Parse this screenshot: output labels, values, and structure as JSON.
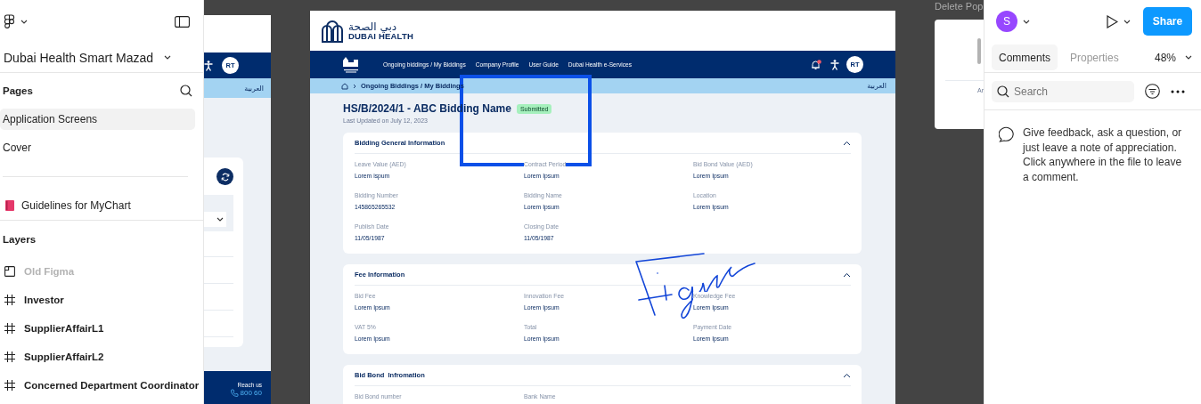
{
  "left_panel": {
    "file_title": "Dubai Health Smart Mazad",
    "pages_heading": "Pages",
    "pages": [
      {
        "label": "Application Screens",
        "selected": true
      },
      {
        "label": "Cover",
        "selected": false
      }
    ],
    "pinned_page": "Guidelines for MyChart",
    "layers_heading": "Layers",
    "layers": [
      {
        "label": "Old Figma",
        "kind": "section",
        "dimmed": true
      },
      {
        "label": "Investor",
        "kind": "frame",
        "dimmed": false
      },
      {
        "label": "SupplierAffairL1",
        "kind": "frame",
        "dimmed": false
      },
      {
        "label": "SupplierAffairL2",
        "kind": "frame",
        "dimmed": false
      },
      {
        "label": "Concerned Department  Coordinator",
        "kind": "frame",
        "dimmed": false
      }
    ]
  },
  "canvas": {
    "left_frame": {
      "avatar": "RT",
      "language": "العربية",
      "footer_label": "Reach us",
      "footer_phone": "800 60"
    },
    "main_frame": {
      "logo_arabic": "دبي الصحة",
      "logo_latin": "DUBAI HEALTH",
      "nav": [
        "Ongoing biddings / My Biddings",
        "Company Profile",
        "User Guide",
        "Dubai Health e-Services"
      ],
      "avatar": "RT",
      "breadcrumb": "Ongoing Biddings / My Biddings",
      "language": "العربية",
      "title": "HS/B/2024/1 - ABC Bidding Name",
      "status": "Submitted",
      "updated": "Last Updated on July 12, 2023",
      "sections": [
        {
          "title": "Bidding General Information",
          "expanded": true,
          "fields": [
            {
              "label": "Leave Value (AED)",
              "value": "Lorem ispum"
            },
            {
              "label": "Contract Period",
              "value": "Lorem Ipsum"
            },
            {
              "label": "Bid Bond Value (AED)",
              "value": "Lorem Ipsum"
            },
            {
              "label": "Bidding Number",
              "value": "145865265532"
            },
            {
              "label": "Bidding Name",
              "value": "Lorem Ipsum"
            },
            {
              "label": "Location",
              "value": "Lorem Ipsum"
            },
            {
              "label": "Publish Date",
              "value": "11/05/1987"
            },
            {
              "label": "Closing Date",
              "value": "11/05/1987"
            }
          ]
        },
        {
          "title": "Fee Information",
          "expanded": true,
          "fields": [
            {
              "label": "Bid Fee",
              "value": "Lorem Ipsum"
            },
            {
              "label": "Innovation Fee",
              "value": "Lorem Ipsum"
            },
            {
              "label": "Knowledge Fee",
              "value": "Lorem Ipsum"
            },
            {
              "label": "VAT 5%",
              "value": "Lorem Ipsum"
            },
            {
              "label": "Total",
              "value": "Lorem Ipsum"
            },
            {
              "label": "Payment Date",
              "value": "Lorem Ipsum"
            }
          ]
        },
        {
          "title": "Bid Bond  Infromation",
          "expanded": true,
          "fields": [
            {
              "label": "Bid Bond number"
            },
            {
              "label": "Bank Name"
            }
          ]
        }
      ]
    },
    "side_frame": {
      "title": "Delete Pop",
      "link": "Ar"
    }
  },
  "right_panel": {
    "avatar": "S",
    "share": "Share",
    "tabs": [
      {
        "label": "Comments",
        "selected": true
      },
      {
        "label": "Properties",
        "selected": false
      }
    ],
    "zoom": "48%",
    "search_placeholder": "Search",
    "empty_message": "Give feedback, ask a question, or just leave a note of appreciation. Click anywhere in the file to leave a comment."
  }
}
